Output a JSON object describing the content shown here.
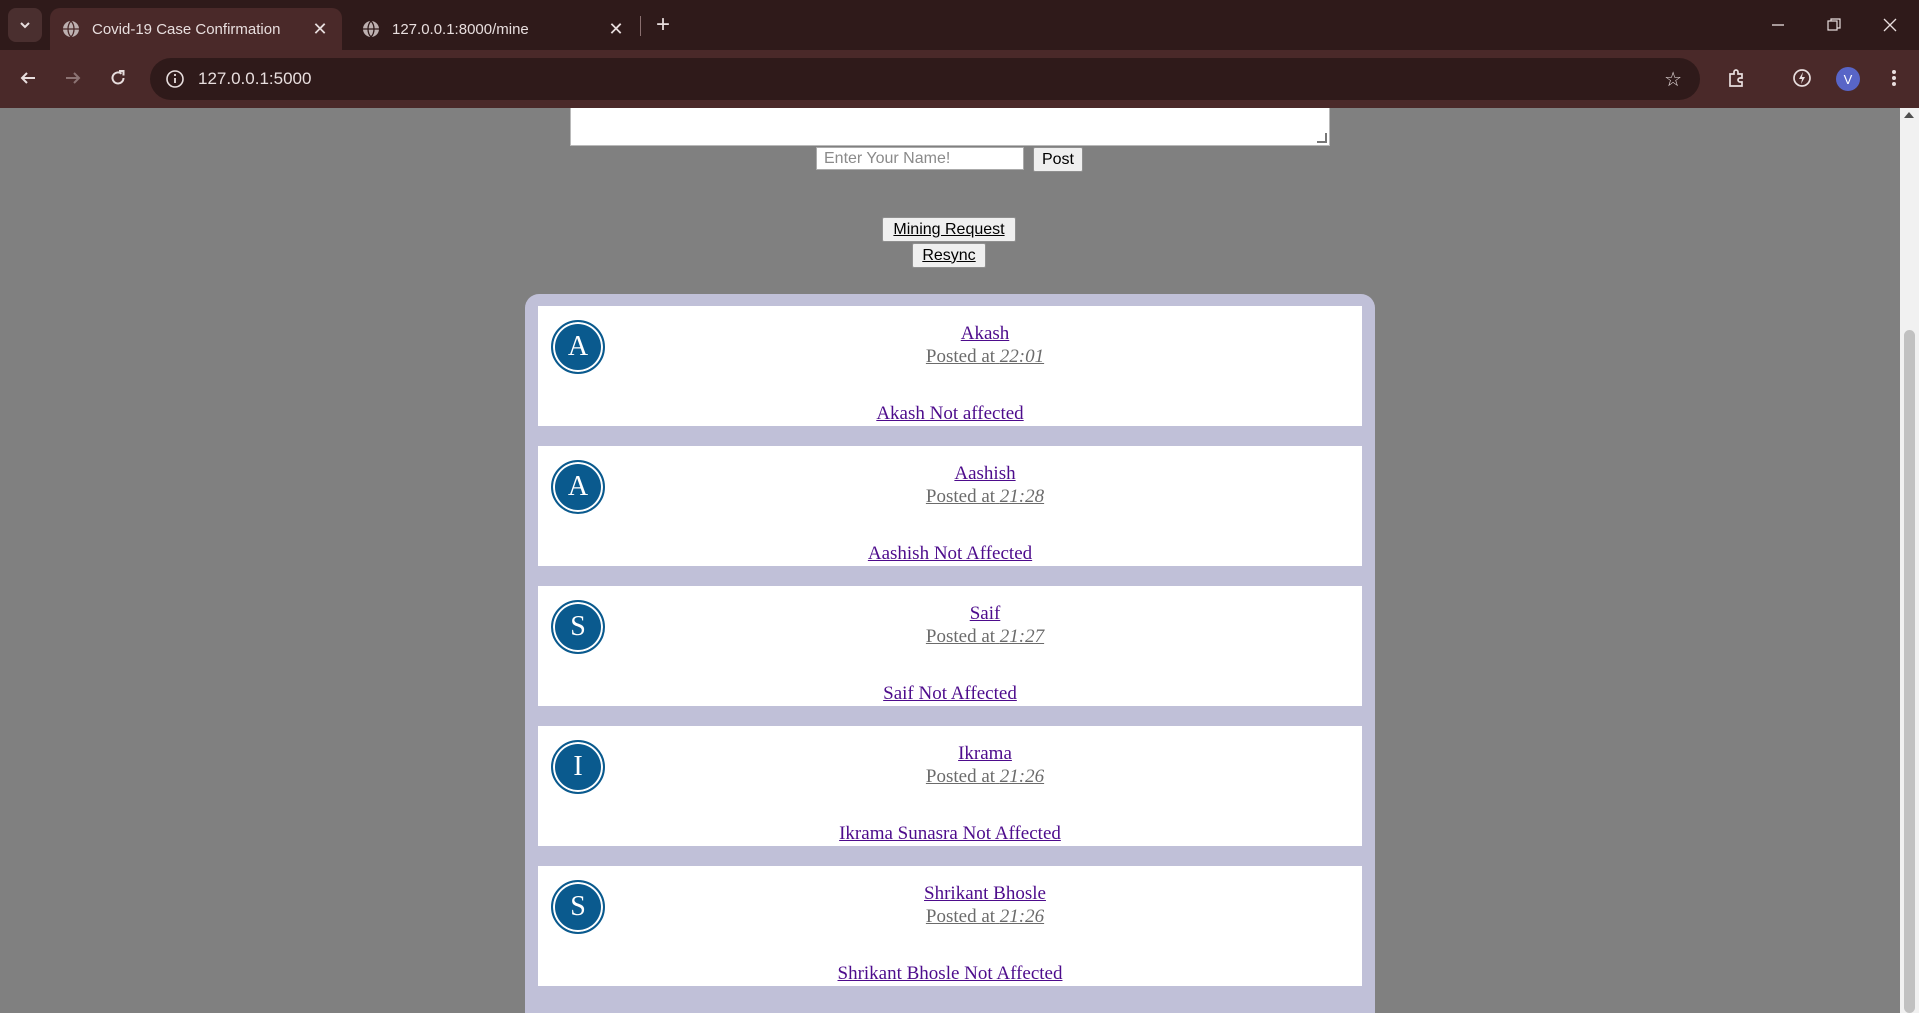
{
  "browser": {
    "tabs": [
      {
        "title": "Covid-19 Case Confirmation",
        "active": true,
        "icon": "globe-icon"
      },
      {
        "title": "127.0.0.1:8000/mine",
        "active": false,
        "icon": "globe-icon"
      }
    ],
    "url": "127.0.0.1:5000",
    "profile_initial": "V"
  },
  "form": {
    "name_placeholder": "Enter Your Name!",
    "post_label": "Post",
    "mining_label": "Mining Request",
    "resync_label": "Resync"
  },
  "posts": [
    {
      "initial": "A",
      "name": "Akash",
      "posted_prefix": "Posted at",
      "time": "22:01",
      "message": "Akash Not affected"
    },
    {
      "initial": "A",
      "name": "Aashish",
      "posted_prefix": "Posted at",
      "time": "21:28",
      "message": "Aashish Not Affected"
    },
    {
      "initial": "S",
      "name": "Saif",
      "posted_prefix": "Posted at",
      "time": "21:27",
      "message": "Saif Not Affected"
    },
    {
      "initial": "I",
      "name": "Ikrama",
      "posted_prefix": "Posted at",
      "time": "21:26",
      "message": "Ikrama Sunasra Not Affected"
    },
    {
      "initial": "S",
      "name": "Shrikant Bhosle",
      "posted_prefix": "Posted at",
      "time": "21:26",
      "message": "Shrikant Bhosle Not Affected"
    }
  ],
  "colors": {
    "avatar": "#0a5a8e",
    "link": "#4d0c8c",
    "page_background": "#808080",
    "feed_background": "#c0c0d8"
  }
}
